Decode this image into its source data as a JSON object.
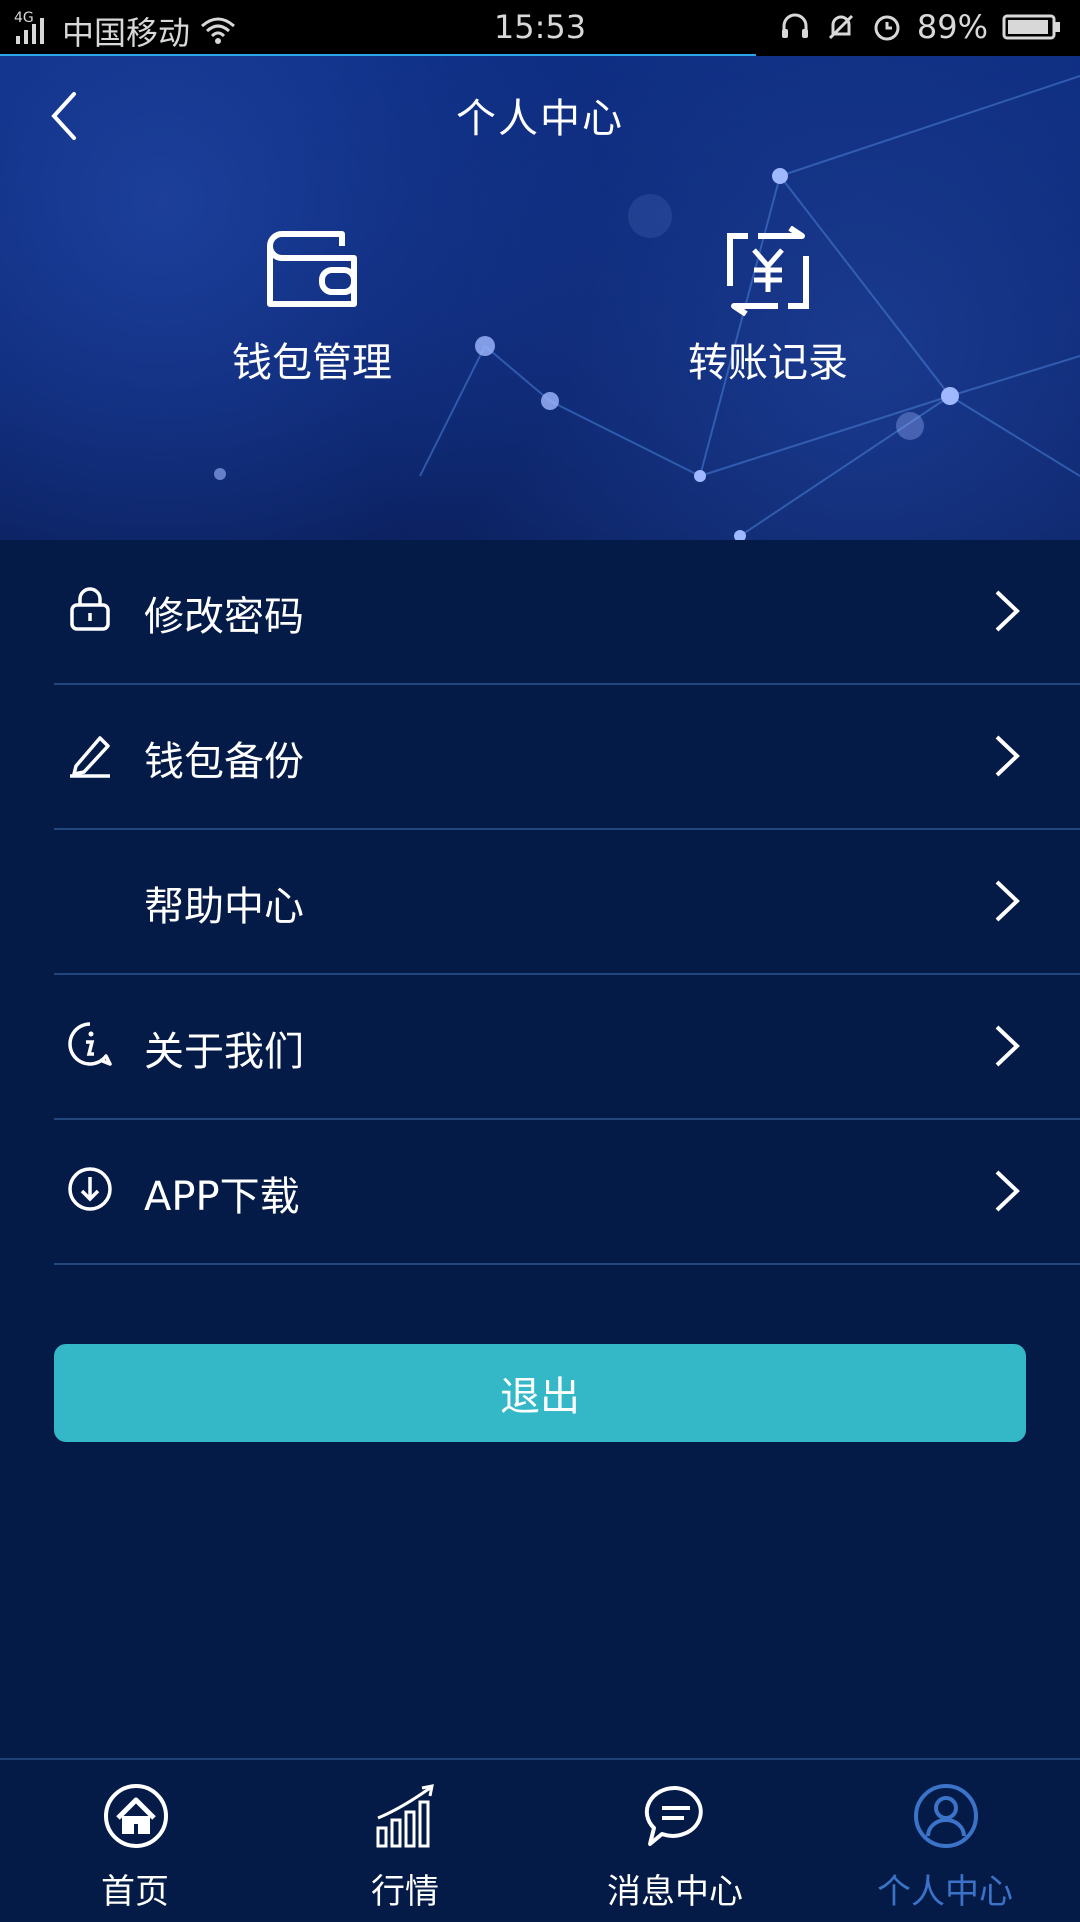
{
  "status_bar": {
    "network": "4G",
    "carrier": "中国移动",
    "time": "15:53",
    "battery": "89%",
    "icons": [
      "signal-icon",
      "wifi-icon",
      "headset-icon",
      "bell-muted-icon",
      "alarm-icon",
      "battery-icon"
    ]
  },
  "header": {
    "title": "个人中心",
    "back_icon": "chevron-left-icon"
  },
  "quick_actions": [
    {
      "label": "钱包管理",
      "icon": "wallet-icon"
    },
    {
      "label": "转账记录",
      "icon": "yuan-transfer-icon"
    }
  ],
  "menu": [
    {
      "label": "修改密码",
      "icon": "lock-icon"
    },
    {
      "label": "钱包备份",
      "icon": "pencil-icon"
    },
    {
      "label": "帮助中心",
      "icon": ""
    },
    {
      "label": "关于我们",
      "icon": "info-icon"
    },
    {
      "label": "APP下载",
      "icon": "download-icon"
    }
  ],
  "logout_label": "退出",
  "bottom_nav": [
    {
      "label": "首页",
      "icon": "home-icon",
      "active": false
    },
    {
      "label": "行情",
      "icon": "chart-icon",
      "active": false
    },
    {
      "label": "消息中心",
      "icon": "message-icon",
      "active": false
    },
    {
      "label": "个人中心",
      "icon": "user-icon",
      "active": true
    }
  ],
  "colors": {
    "background": "#041a47",
    "accent_button": "#34b8c8",
    "active_tab": "#3b73c9",
    "divider": "#21477c"
  }
}
